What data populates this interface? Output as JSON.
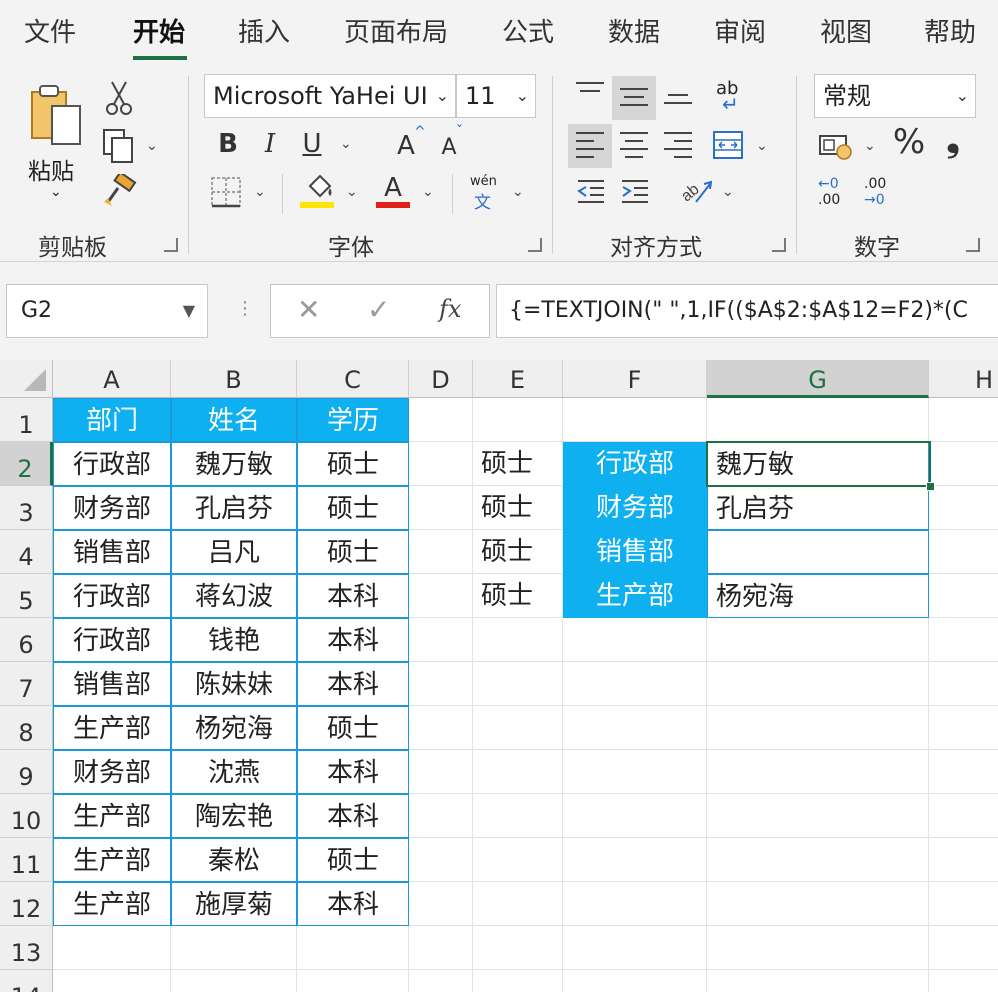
{
  "ribbon": {
    "tabs": [
      "文件",
      "开始",
      "插入",
      "页面布局",
      "公式",
      "数据",
      "审阅",
      "视图",
      "帮助"
    ],
    "active_tab": "开始",
    "clipboard": {
      "paste_label": "粘贴",
      "group_label": "剪贴板"
    },
    "font": {
      "font_name": "Microsoft YaHei UI",
      "font_size": "11",
      "bold": "B",
      "italic": "I",
      "underline": "U",
      "grow": "A",
      "shrink": "A",
      "font_color_glyph": "A",
      "phonetic_top": "wén",
      "phonetic_bottom": "文",
      "group_label": "字体",
      "fill_color": "#ffe600",
      "font_color": "#e0201b"
    },
    "alignment": {
      "wrap_glyph": "ab",
      "group_label": "对齐方式"
    },
    "number": {
      "format": "常规",
      "percent": "%",
      "comma": "❟",
      "inc_decimal_top": "←0",
      "inc_decimal_bottom": ".00",
      "dec_decimal_top": ".00",
      "dec_decimal_bottom": "→0",
      "group_label": "数字"
    }
  },
  "formula_bar": {
    "name_box": "G2",
    "cancel": "✕",
    "enter": "✓",
    "fx": "fx",
    "formula": "{=TEXTJOIN(\"  \",1,IF(($A$2:$A$12=F2)*(C"
  },
  "sheet": {
    "columns": [
      "A",
      "B",
      "C",
      "D",
      "E",
      "F",
      "G",
      "H"
    ],
    "rows": [
      "1",
      "2",
      "3",
      "4",
      "5",
      "6",
      "7",
      "8",
      "9",
      "10",
      "11",
      "12",
      "13",
      "14"
    ],
    "selected_column": "G",
    "selected_row": "2",
    "table_headers": [
      "部门",
      "姓名",
      "学历"
    ],
    "table_rows": [
      [
        "行政部",
        "魏万敏",
        "硕士"
      ],
      [
        "财务部",
        "孔启芬",
        "硕士"
      ],
      [
        "销售部",
        "吕凡",
        "硕士"
      ],
      [
        "行政部",
        "蒋幻波",
        "本科"
      ],
      [
        "行政部",
        "钱艳",
        "本科"
      ],
      [
        "销售部",
        "陈妹妹",
        "本科"
      ],
      [
        "生产部",
        "杨宛海",
        "硕士"
      ],
      [
        "财务部",
        "沈燕",
        "本科"
      ],
      [
        "生产部",
        "陶宏艳",
        "本科"
      ],
      [
        "生产部",
        "秦松",
        "硕士"
      ],
      [
        "生产部",
        "施厚菊",
        "本科"
      ]
    ],
    "lookup_rows": [
      {
        "e": "硕士",
        "f": "行政部",
        "g": "魏万敏"
      },
      {
        "e": "硕士",
        "f": "财务部",
        "g": "孔启芬"
      },
      {
        "e": "硕士",
        "f": "销售部",
        "g": ""
      },
      {
        "e": "硕士",
        "f": "生产部",
        "g": "杨宛海"
      }
    ],
    "header_color": "#0eb0f0",
    "selection_color": "#1e7145"
  }
}
